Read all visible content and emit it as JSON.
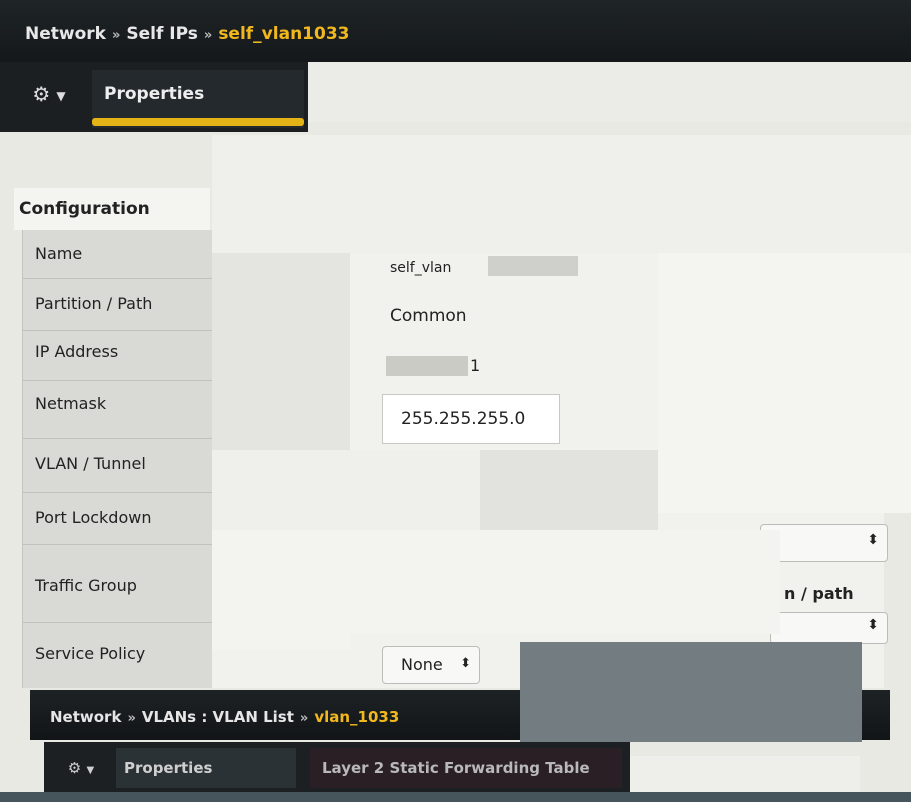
{
  "breadcrumb": {
    "section": "Network",
    "separator": "»",
    "page": "Self IPs",
    "current": "self_vlan1033"
  },
  "tabs": {
    "gear_icon": "gear-icon",
    "properties_label": "Properties"
  },
  "config": {
    "header": "Configuration",
    "labels": {
      "name": "Name",
      "partition": "Partition / Path",
      "ip_address": "IP Address",
      "netmask": "Netmask",
      "vlan_tunnel": "VLAN / Tunnel",
      "port_lockdown": "Port Lockdown",
      "traffic_group": "Traffic Group",
      "service_policy": "Service Policy"
    },
    "values": {
      "name": "self_vlan",
      "partition": "Common",
      "ip_address": "1",
      "netmask": "255.255.255.0",
      "traffic_group_suffix": "n / path",
      "service_policy": "None"
    }
  },
  "bottom": {
    "breadcrumb": {
      "section": "Network",
      "separator": "»",
      "page": "VLANs : VLAN List",
      "current": "vlan_1033"
    },
    "tabs": {
      "properties_label": "Properties",
      "l2_label": "Layer 2 Static Forwarding Table"
    }
  }
}
